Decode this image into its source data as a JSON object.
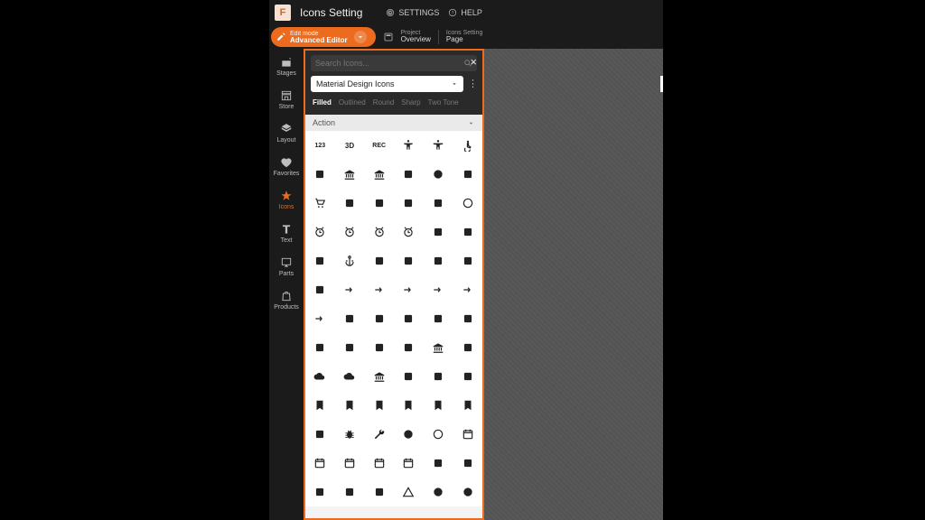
{
  "header": {
    "logo_letter": "F",
    "title": "Icons Setting",
    "settings_label": "SETTINGS",
    "help_label": "HELP"
  },
  "modebar": {
    "small": "Edit mode",
    "big": "Advanced Editor",
    "crumbs": [
      {
        "small": "Project",
        "big": "Overview"
      },
      {
        "small": "Icons Setting",
        "big": "Page"
      }
    ]
  },
  "sidebar": [
    {
      "id": "stages",
      "label": "Stages",
      "icon": "movie"
    },
    {
      "id": "store",
      "label": "Store",
      "icon": "store"
    },
    {
      "id": "layout",
      "label": "Layout",
      "icon": "layers"
    },
    {
      "id": "favorites",
      "label": "Favorites",
      "icon": "heart"
    },
    {
      "id": "icons",
      "label": "Icons",
      "icon": "star",
      "active": true
    },
    {
      "id": "text",
      "label": "Text",
      "icon": "text"
    },
    {
      "id": "parts",
      "label": "Parts",
      "icon": "parts"
    },
    {
      "id": "products",
      "label": "Products",
      "icon": "bag"
    }
  ],
  "panel": {
    "search_placeholder": "Search Icons...",
    "library_selected": "Material Design Icons",
    "style_tabs": [
      "Filled",
      "Outlined",
      "Round",
      "Sharp",
      "Two Tone"
    ],
    "active_tab": 0,
    "category": "Action",
    "icons": [
      "123",
      "3d-rotation",
      "rec",
      "accessibility",
      "accessibility-new",
      "accessible",
      "accessible-forward",
      "account-balance",
      "account-balance-wallet",
      "account-box",
      "account-circle",
      "add-card",
      "add-shopping-cart",
      "add-task",
      "add-to-drive",
      "addchart",
      "admin-panel-settings",
      "ads-click",
      "alarm",
      "alarm-add",
      "alarm-off",
      "alarm-on",
      "all-inbox",
      "all-out",
      "analytics",
      "anchor",
      "android",
      "announcement",
      "api",
      "app-blocking",
      "app-shortcut",
      "arrow-circle-down",
      "arrow-circle-left",
      "arrow-circle-right",
      "arrow-circle-up",
      "arrow-outward",
      "arrow-right-alt",
      "article",
      "aspect-ratio",
      "assessment",
      "assignment",
      "assignment-ind",
      "assignment-late",
      "assignment-return",
      "assignment-returned",
      "assignment-turned-in",
      "assured-workload",
      "autorenew",
      "backup",
      "backup-table",
      "balance",
      "batch-prediction",
      "book",
      "book-online",
      "bookmark",
      "bookmark-add",
      "bookmark-added",
      "bookmark-border",
      "bookmark-remove",
      "bookmarks",
      "browse-gallery",
      "bug-report",
      "build",
      "build-circle",
      "cached",
      "calendar-month",
      "calendar-today",
      "calendar-view-day",
      "calendar-view-month",
      "calendar-view-week",
      "camera-enhance",
      "cancel-schedule-send",
      "card-giftcard",
      "card-membership",
      "card-travel",
      "change-history",
      "check-circle",
      "check-circle-outline"
    ]
  }
}
